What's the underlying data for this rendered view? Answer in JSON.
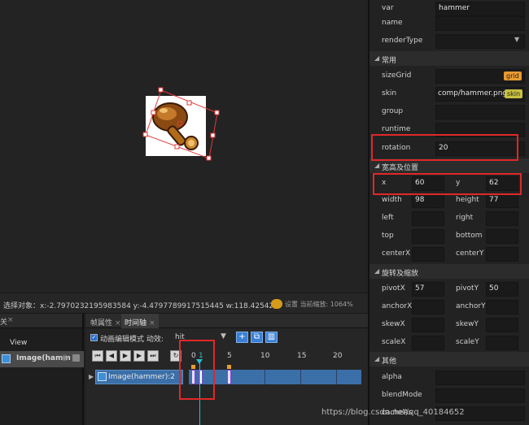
{
  "colors": {
    "accent": "#3a7fd5",
    "highlight": "#e02828",
    "playhead": "#29c0d0",
    "keyframe_tick": "#e8a030"
  },
  "status": {
    "text": "选择对象：x:-2.7970232195983584 y:-4.4797789917515445 w:118.42542764 ...",
    "right": "设置  当前缩放: 1064%"
  },
  "hierarchy": {
    "tab": "关",
    "items": [
      {
        "label": "View"
      },
      {
        "label": "Image(hamm"
      }
    ]
  },
  "timeline": {
    "tabs": [
      {
        "label": "帧属性"
      },
      {
        "label": "时间轴"
      }
    ],
    "options": {
      "checkbox_label": "动画编辑模式  动效:",
      "anim_value": "hit",
      "dropdown": "▼"
    },
    "ruler": [
      "0",
      "1",
      "5",
      "10",
      "15",
      "20"
    ],
    "track_name": "Image(hammer):2"
  },
  "props": {
    "rows_top": [
      {
        "label": "var",
        "value": "hammer"
      },
      {
        "label": "name",
        "value": ""
      },
      {
        "label": "renderType",
        "value": ""
      }
    ],
    "sec_common": "常用",
    "sizeGrid": {
      "label": "sizeGrid",
      "badge": "grid"
    },
    "skin": {
      "label": "skin",
      "value": "comp/hammer.png",
      "badge": "skin"
    },
    "group": {
      "label": "group"
    },
    "runtime": {
      "label": "runtime"
    },
    "rotation": {
      "label": "rotation",
      "value": "20"
    },
    "sec_size": "宽高及位置",
    "x": {
      "label": "x",
      "value": "60"
    },
    "y": {
      "label": "y",
      "value": "62"
    },
    "width": {
      "label": "width",
      "value": "98"
    },
    "height": {
      "label": "height",
      "value": "77"
    },
    "left": {
      "label": "left"
    },
    "right": {
      "label": "right"
    },
    "top": {
      "label": "top"
    },
    "bottom": {
      "label": "bottom"
    },
    "centerX": {
      "label": "centerX"
    },
    "centerY": {
      "label": "centerY"
    },
    "sec_rotate": "旋转及缩放",
    "pivotX": {
      "label": "pivotX",
      "value": "57"
    },
    "pivotY": {
      "label": "pivotY",
      "value": "50"
    },
    "anchorX": {
      "label": "anchorX"
    },
    "anchorY": {
      "label": "anchorY"
    },
    "skewX": {
      "label": "skewX"
    },
    "skewY": {
      "label": "skewY"
    },
    "scaleX": {
      "label": "scaleX"
    },
    "scaleY": {
      "label": "scaleY"
    },
    "sec_other": "其他",
    "alpha": {
      "label": "alpha"
    },
    "blendMode": {
      "label": "blendMode"
    },
    "cacheAs": {
      "label": "cacheAs"
    }
  },
  "watermark": "https://blog.csdn.net/qq_40184652"
}
